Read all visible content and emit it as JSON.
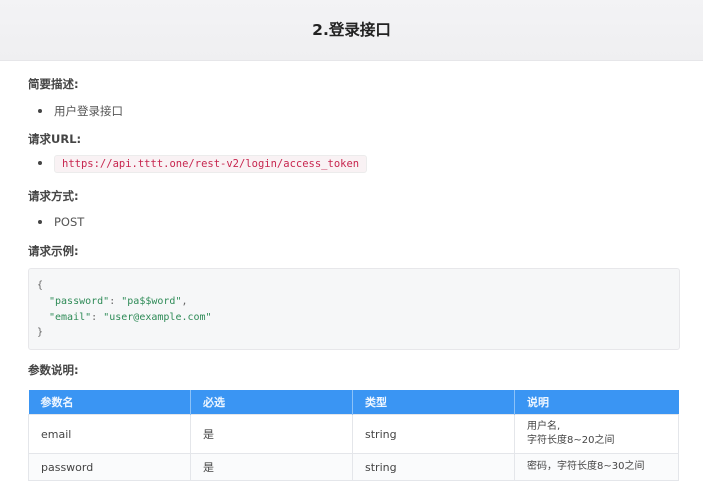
{
  "header": {
    "title": "2.登录接口"
  },
  "sections": {
    "summary_label": "简要描述:",
    "summary_item": "用户登录接口",
    "url_label": "请求URL:",
    "url_value": "https://api.tttt.one/rest-v2/login/access_token",
    "method_label": "请求方式:",
    "method_value": "POST",
    "example_label": "请求示例:",
    "params_label": "参数说明:"
  },
  "code_example": {
    "open": "{",
    "line1_key": "\"password\"",
    "line1_value": "\"pa$$word\"",
    "line2_key": "\"email\"",
    "line2_value": "\"user@example.com\"",
    "close": "}"
  },
  "table": {
    "headers": [
      "参数名",
      "必选",
      "类型",
      "说明"
    ],
    "rows": [
      {
        "name": "email",
        "required": "是",
        "type": "string",
        "desc_line1": "用户名,",
        "desc_line2": "字符长度8~20之间"
      },
      {
        "name": "password",
        "required": "是",
        "type": "string",
        "desc_line1": "密码，字符长度8~30之间"
      }
    ]
  }
}
